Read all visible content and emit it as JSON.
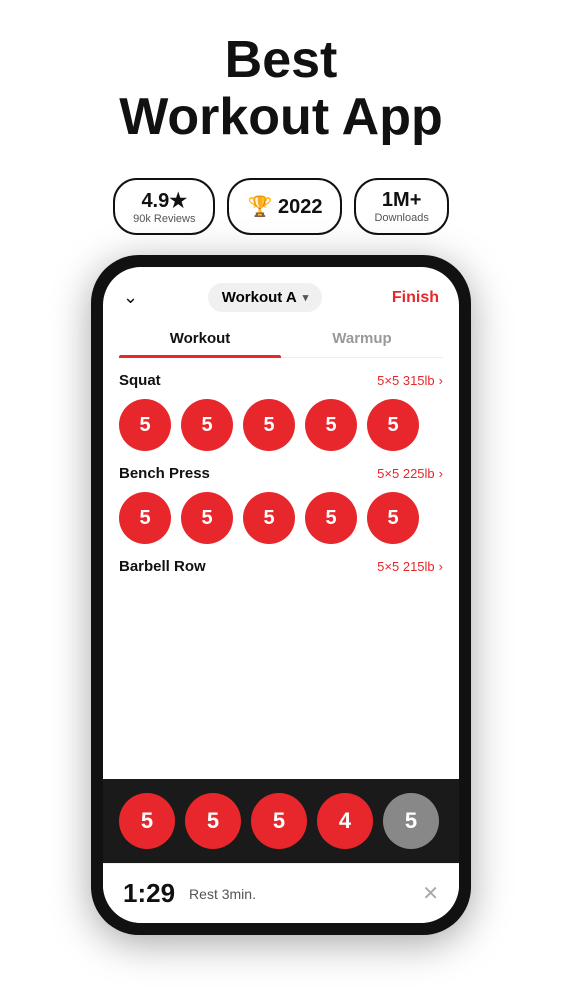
{
  "header": {
    "title_line1": "Best",
    "title_line2": "Workout App"
  },
  "badges": [
    {
      "id": "rating",
      "main": "4.9★",
      "sub": "90k Reviews"
    },
    {
      "id": "award",
      "main": "🏆 2022",
      "sub": ""
    },
    {
      "id": "downloads",
      "main": "1M+",
      "sub": "Downloads"
    }
  ],
  "app": {
    "workout_selector": "Workout A",
    "finish_label": "Finish",
    "tabs": [
      {
        "id": "workout",
        "label": "Workout",
        "active": true
      },
      {
        "id": "warmup",
        "label": "Warmup",
        "active": false
      }
    ],
    "exercises": [
      {
        "name": "Squat",
        "sets_label": "5×5 315lb",
        "sets": [
          5,
          5,
          5,
          5,
          5
        ],
        "gray": []
      },
      {
        "name": "Bench Press",
        "sets_label": "5×5 225lb",
        "sets": [
          5,
          5,
          5,
          5,
          5
        ],
        "gray": []
      },
      {
        "name": "Barbell Row",
        "sets_label": "5×5 215lb",
        "sets": [
          5,
          5,
          5,
          4,
          5
        ],
        "gray": [
          4
        ]
      }
    ],
    "bottom_sets": [
      5,
      5,
      5,
      4,
      5
    ],
    "bottom_gray_index": 4,
    "timer": {
      "time": "1:29",
      "label": "Rest 3min."
    }
  }
}
